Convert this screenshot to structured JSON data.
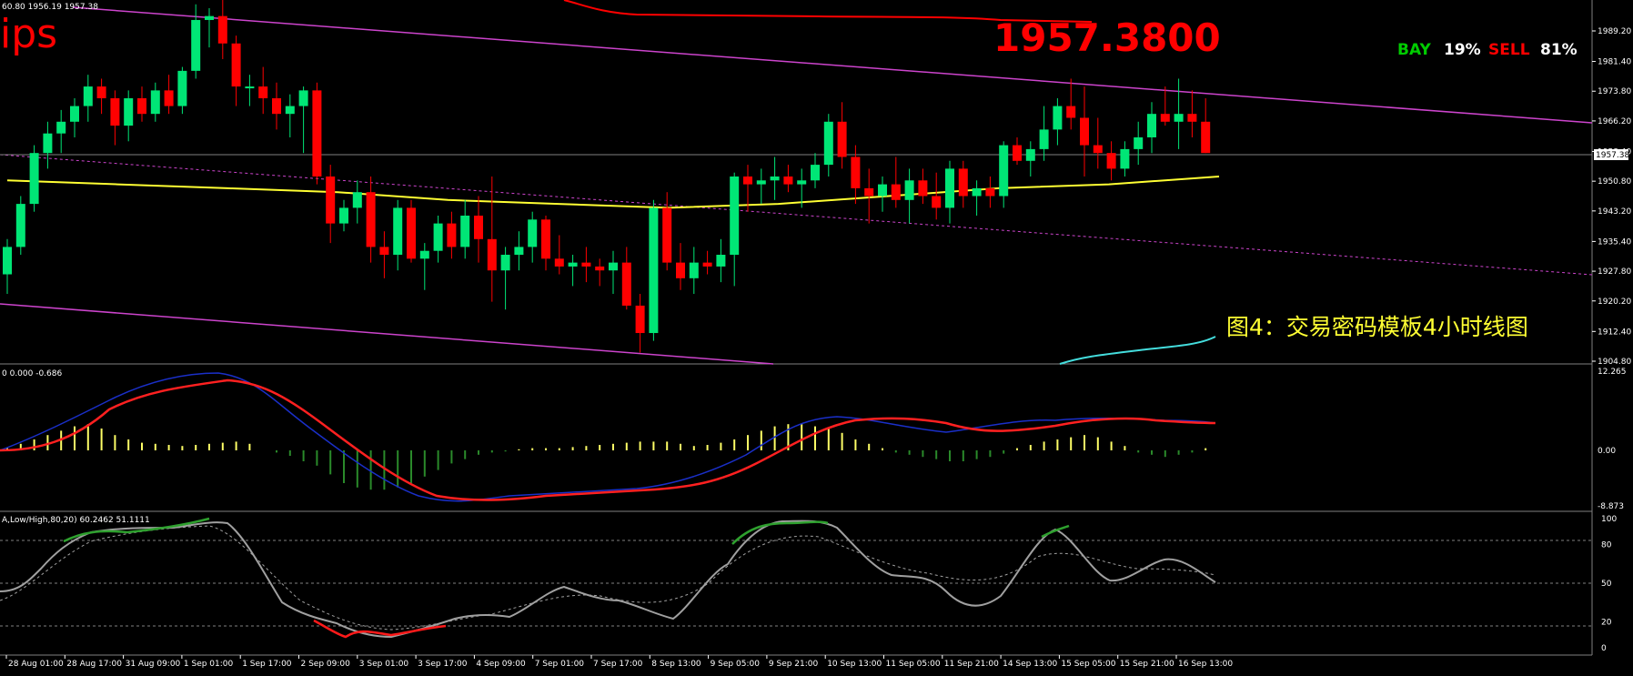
{
  "colors": {
    "background": "#000000",
    "bull": "#00e676",
    "bear": "#ff0000",
    "ma_yellow": "#ffff33",
    "channel": "#cc44cc",
    "cyan": "#44dddd",
    "macd_signal": "#ff2020",
    "macd_main": "#1a2fc8",
    "hist_pos": "#ffff66",
    "hist_neg": "#2a8a2a",
    "stoch_main": "#a0a0a0",
    "stoch_green": "#2ea02e",
    "stoch_red": "#ff1a1a",
    "axis_text": "#ffffff",
    "grid": "#808080"
  },
  "main": {
    "header_text": "60.80 1956.19 1957.38",
    "logo_text": "ips",
    "big_price": "1957.3800",
    "bay_label": "BAY",
    "bay_value": "19%",
    "sell_label": "SELL",
    "sell_value": "81%",
    "caption": "图4：交易密码模板4小时线图",
    "current_price_tag": "1957.38",
    "price_ticks": [
      "1989.20",
      "1981.40",
      "1973.80",
      "1966.20",
      "1958.40",
      "1950.80",
      "1943.20",
      "1935.40",
      "1927.80",
      "1920.20",
      "1912.40",
      "1904.80"
    ]
  },
  "macd": {
    "header_text": "0 0.000 -0.686",
    "ticks": [
      "12.265",
      "0.00",
      "-8.873"
    ]
  },
  "stoch": {
    "header_text": "A,Low/High,80,20) 60.2462 51.1111",
    "ticks": [
      "100",
      "80",
      "50",
      "20",
      "0"
    ]
  },
  "time_axis": {
    "labels": [
      "28 Aug 01:00",
      "28 Aug 17:00",
      "31 Aug 09:00",
      "1 Sep 01:00",
      "1 Sep 17:00",
      "2 Sep 09:00",
      "3 Sep 01:00",
      "3 Sep 17:00",
      "4 Sep 09:00",
      "7 Sep 01:00",
      "7 Sep 17:00",
      "8 Sep 13:00",
      "9 Sep 05:00",
      "9 Sep 21:00",
      "10 Sep 13:00",
      "11 Sep 05:00",
      "11 Sep 21:00",
      "14 Sep 13:00",
      "15 Sep 05:00",
      "15 Sep 21:00",
      "16 Sep 13:00"
    ]
  },
  "chart_data": {
    "type": "candlestick",
    "symbol_price_range": [
      1904.8,
      1989.2
    ],
    "candles": [
      [
        1927,
        1936,
        1922,
        1934
      ],
      [
        1934,
        1947,
        1932,
        1945
      ],
      [
        1945,
        1960,
        1943,
        1958
      ],
      [
        1958,
        1966,
        1954,
        1963
      ],
      [
        1963,
        1969,
        1958,
        1966
      ],
      [
        1966,
        1972,
        1962,
        1970
      ],
      [
        1970,
        1978,
        1966,
        1975
      ],
      [
        1975,
        1977,
        1968,
        1972
      ],
      [
        1972,
        1974,
        1960,
        1965
      ],
      [
        1965,
        1974,
        1961,
        1972
      ],
      [
        1972,
        1975,
        1966,
        1968
      ],
      [
        1968,
        1976,
        1966,
        1974
      ],
      [
        1974,
        1978,
        1968,
        1970
      ],
      [
        1970,
        1980,
        1968,
        1979
      ],
      [
        1979,
        1996,
        1977,
        1992
      ],
      [
        1992,
        1995,
        1985,
        1993
      ],
      [
        1993,
        1998,
        1982,
        1986
      ],
      [
        1986,
        1988,
        1970,
        1975
      ],
      [
        1975,
        1978,
        1970,
        1975
      ],
      [
        1975,
        1980,
        1968,
        1972
      ],
      [
        1972,
        1976,
        1964,
        1968
      ],
      [
        1968,
        1973,
        1962,
        1970
      ],
      [
        1970,
        1975,
        1958,
        1974
      ],
      [
        1974,
        1976,
        1950,
        1952
      ],
      [
        1952,
        1955,
        1935,
        1940
      ],
      [
        1940,
        1946,
        1938,
        1944
      ],
      [
        1944,
        1951,
        1940,
        1948
      ],
      [
        1948,
        1952,
        1930,
        1934
      ],
      [
        1934,
        1938,
        1926,
        1932
      ],
      [
        1932,
        1946,
        1928,
        1944
      ],
      [
        1944,
        1946,
        1930,
        1931
      ],
      [
        1931,
        1935,
        1923,
        1933
      ],
      [
        1933,
        1942,
        1930,
        1940
      ],
      [
        1940,
        1943,
        1931,
        1934
      ],
      [
        1934,
        1946,
        1931,
        1942
      ],
      [
        1942,
        1947,
        1930,
        1936
      ],
      [
        1936,
        1952,
        1920,
        1928
      ],
      [
        1928,
        1934,
        1918,
        1932
      ],
      [
        1932,
        1938,
        1928,
        1934
      ],
      [
        1934,
        1943,
        1930,
        1941
      ],
      [
        1941,
        1942,
        1928,
        1931
      ],
      [
        1931,
        1937,
        1927,
        1929
      ],
      [
        1929,
        1932,
        1924,
        1930
      ],
      [
        1930,
        1934,
        1925,
        1929
      ],
      [
        1929,
        1931,
        1924,
        1928
      ],
      [
        1928,
        1933,
        1922,
        1930
      ],
      [
        1930,
        1934,
        1918,
        1919
      ],
      [
        1919,
        1922,
        1907,
        1912
      ],
      [
        1912,
        1946,
        1910,
        1944
      ],
      [
        1944,
        1948,
        1928,
        1930
      ],
      [
        1930,
        1935,
        1923,
        1926
      ],
      [
        1926,
        1934,
        1922,
        1930
      ],
      [
        1930,
        1933,
        1927,
        1929
      ],
      [
        1929,
        1936,
        1925,
        1932
      ],
      [
        1932,
        1953,
        1924,
        1952
      ],
      [
        1952,
        1955,
        1943,
        1950
      ],
      [
        1950,
        1954,
        1945,
        1951
      ],
      [
        1951,
        1957,
        1946,
        1952
      ],
      [
        1952,
        1955,
        1948,
        1950
      ],
      [
        1950,
        1954,
        1944,
        1951
      ],
      [
        1951,
        1958,
        1949,
        1955
      ],
      [
        1955,
        1968,
        1952,
        1966
      ],
      [
        1966,
        1971,
        1954,
        1957
      ],
      [
        1957,
        1960,
        1945,
        1949
      ],
      [
        1949,
        1954,
        1940,
        1947
      ],
      [
        1947,
        1952,
        1943,
        1950
      ],
      [
        1950,
        1957,
        1944,
        1946
      ],
      [
        1946,
        1954,
        1940,
        1951
      ],
      [
        1951,
        1954,
        1945,
        1947
      ],
      [
        1947,
        1953,
        1941,
        1944
      ],
      [
        1944,
        1956,
        1940,
        1954
      ],
      [
        1954,
        1956,
        1944,
        1947
      ],
      [
        1947,
        1951,
        1942,
        1949
      ],
      [
        1949,
        1952,
        1944,
        1947
      ],
      [
        1947,
        1961,
        1944,
        1960
      ],
      [
        1960,
        1962,
        1955,
        1956
      ],
      [
        1956,
        1961,
        1952,
        1959
      ],
      [
        1959,
        1970,
        1956,
        1964
      ],
      [
        1964,
        1972,
        1960,
        1970
      ],
      [
        1970,
        1977,
        1964,
        1967
      ],
      [
        1967,
        1975,
        1952,
        1960
      ],
      [
        1960,
        1967,
        1954,
        1958
      ],
      [
        1958,
        1961,
        1951,
        1954
      ],
      [
        1954,
        1961,
        1952,
        1959
      ],
      [
        1959,
        1966,
        1955,
        1962
      ],
      [
        1962,
        1971,
        1958,
        1968
      ],
      [
        1968,
        1975,
        1965,
        1966
      ],
      [
        1966,
        1977,
        1959,
        1968
      ],
      [
        1968,
        1974,
        1962,
        1966
      ],
      [
        1966,
        1972,
        1958,
        1958
      ]
    ],
    "ma_yellow": [
      1951,
      1950,
      1949,
      1948,
      1946,
      1945,
      1944,
      1945,
      1947,
      1949,
      1950,
      1952
    ],
    "macd_histogram_range": [
      -8.873,
      12.265
    ],
    "stochastic_levels": [
      80,
      50,
      20
    ]
  }
}
